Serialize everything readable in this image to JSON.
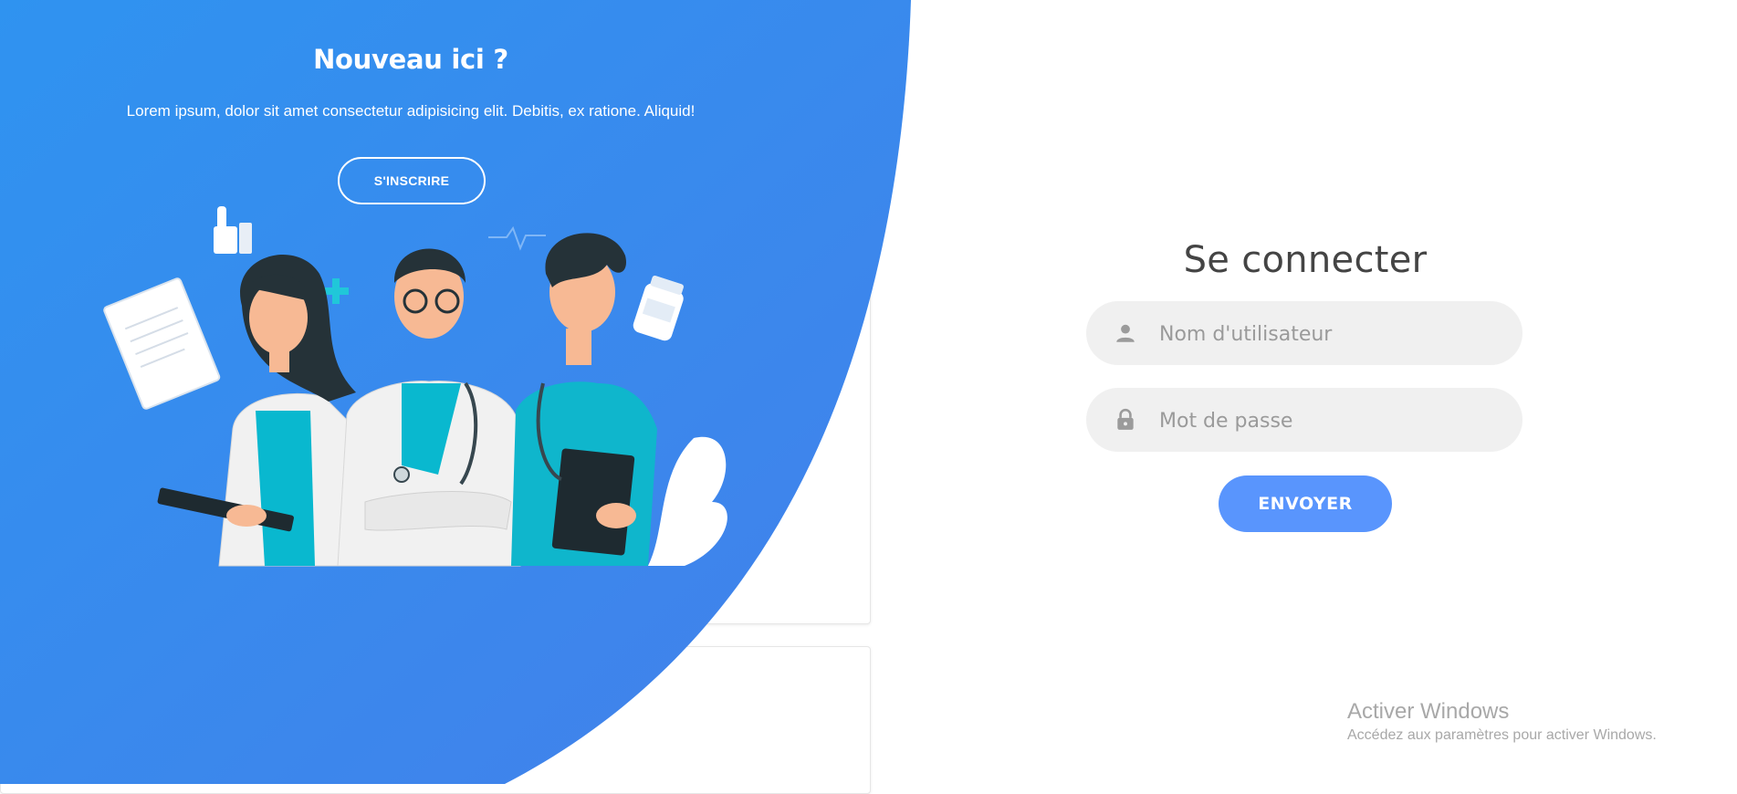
{
  "left_panel": {
    "title": "Nouveau ici ?",
    "text": "Lorem ipsum, dolor sit amet consectetur adipisicing elit. Debitis, ex ratione. Aliquid!",
    "signup_button": "S'INSCRIRE",
    "illustration": "medical-team-illustration",
    "gradient_colors": [
      "#2f8ff0",
      "#3f82ea"
    ]
  },
  "login": {
    "title": "Se connecter",
    "username": {
      "placeholder": "Nom d'utilisateur",
      "icon": "user-icon"
    },
    "password": {
      "placeholder": "Mot de passe",
      "icon": "lock-icon"
    },
    "submit_button": "ENVOYER",
    "accent_color": "#5995fd"
  },
  "watermark": {
    "title": "Activer Windows",
    "subtitle": "Accédez aux paramètres pour activer Windows."
  }
}
